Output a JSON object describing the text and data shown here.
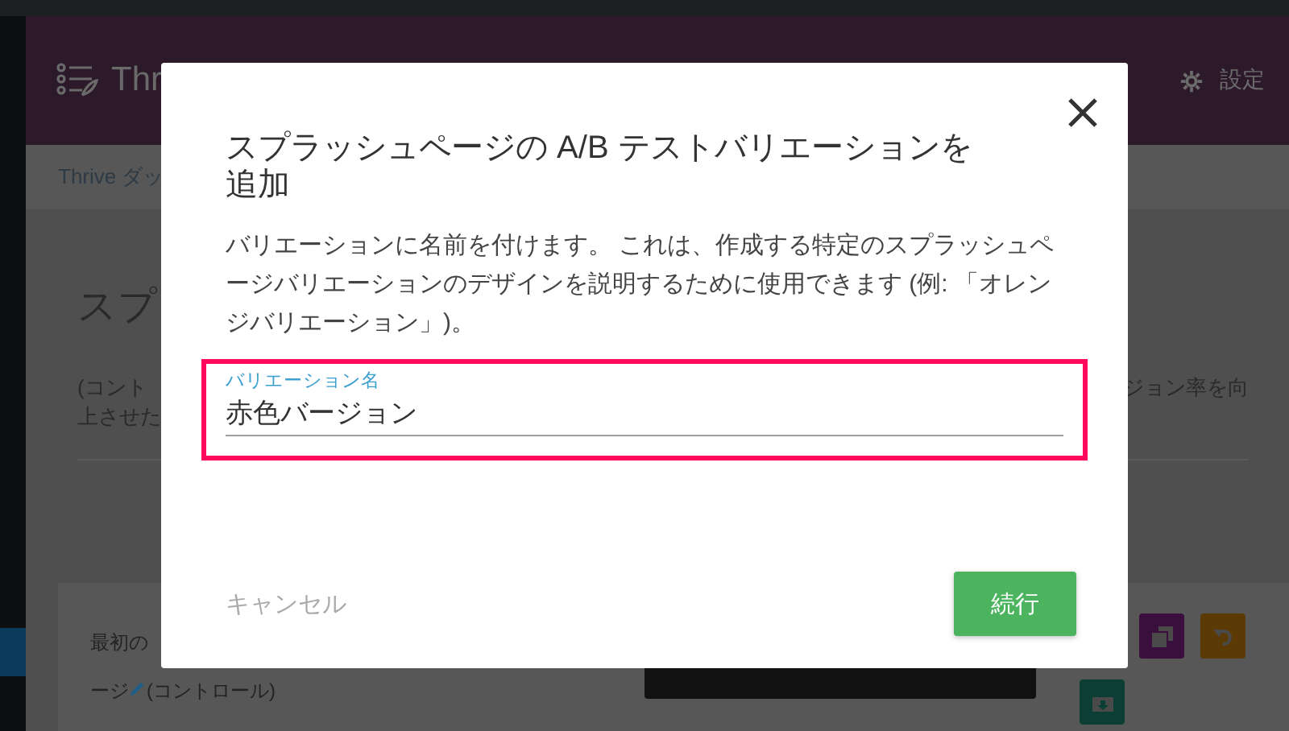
{
  "header": {
    "logo_text": "Thr",
    "settings_label": "設定"
  },
  "breadcrumb": {
    "left": "Thrive ダッ"
  },
  "page": {
    "heading": "スプ",
    "description_left": [
      "(コント",
      "上させた"
    ],
    "description_right": "ジョン率を向"
  },
  "variation_card": {
    "name_lines": [
      "最初の",
      "ージ"
    ],
    "suffix": "(コントロール)"
  },
  "modal": {
    "title": "スプラッシュページの A/B テストバリエーションを追加",
    "description": "バリエーションに名前を付けます。 これは、作成する特定のスプラッシュページバリエーションのデザインを説明するために使用できます (例: 「オレンジバリエーション」)。",
    "field": {
      "label": "バリエーション名",
      "value": "赤色バージョン",
      "highlighted": true
    },
    "cancel": "キャンセル",
    "confirm": "続行"
  }
}
